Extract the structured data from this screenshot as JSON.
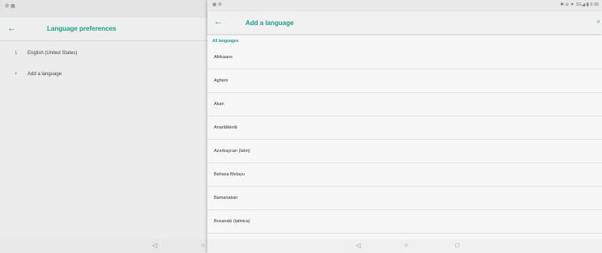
{
  "left_panel": {
    "status_icons": "⚙ ▦",
    "title": "Language preferences",
    "back_icon": "←",
    "languages": [
      {
        "index": "1",
        "label": "English (United States)"
      }
    ],
    "add_icon": "+",
    "add_label": "Add a language",
    "nav": {
      "back": "◁",
      "home": "○"
    }
  },
  "right_panel": {
    "status_left": "▦ ⚙",
    "status_right": "✱ ⊖ ▼ 3G◢ ▮ 9:36",
    "back_icon": "←",
    "title": "Add a language",
    "search_icon": "⌕",
    "section_header": "All languages",
    "languages": [
      "Afrikaans",
      "Aghem",
      "Akan",
      "Anarâškielâ",
      "Azərbaycan (latın)",
      "Bahasa Melayu",
      "Bamanakan",
      "Bosanski (latinica)"
    ],
    "nav": {
      "back": "◁",
      "home": "○",
      "recents": "□"
    }
  }
}
